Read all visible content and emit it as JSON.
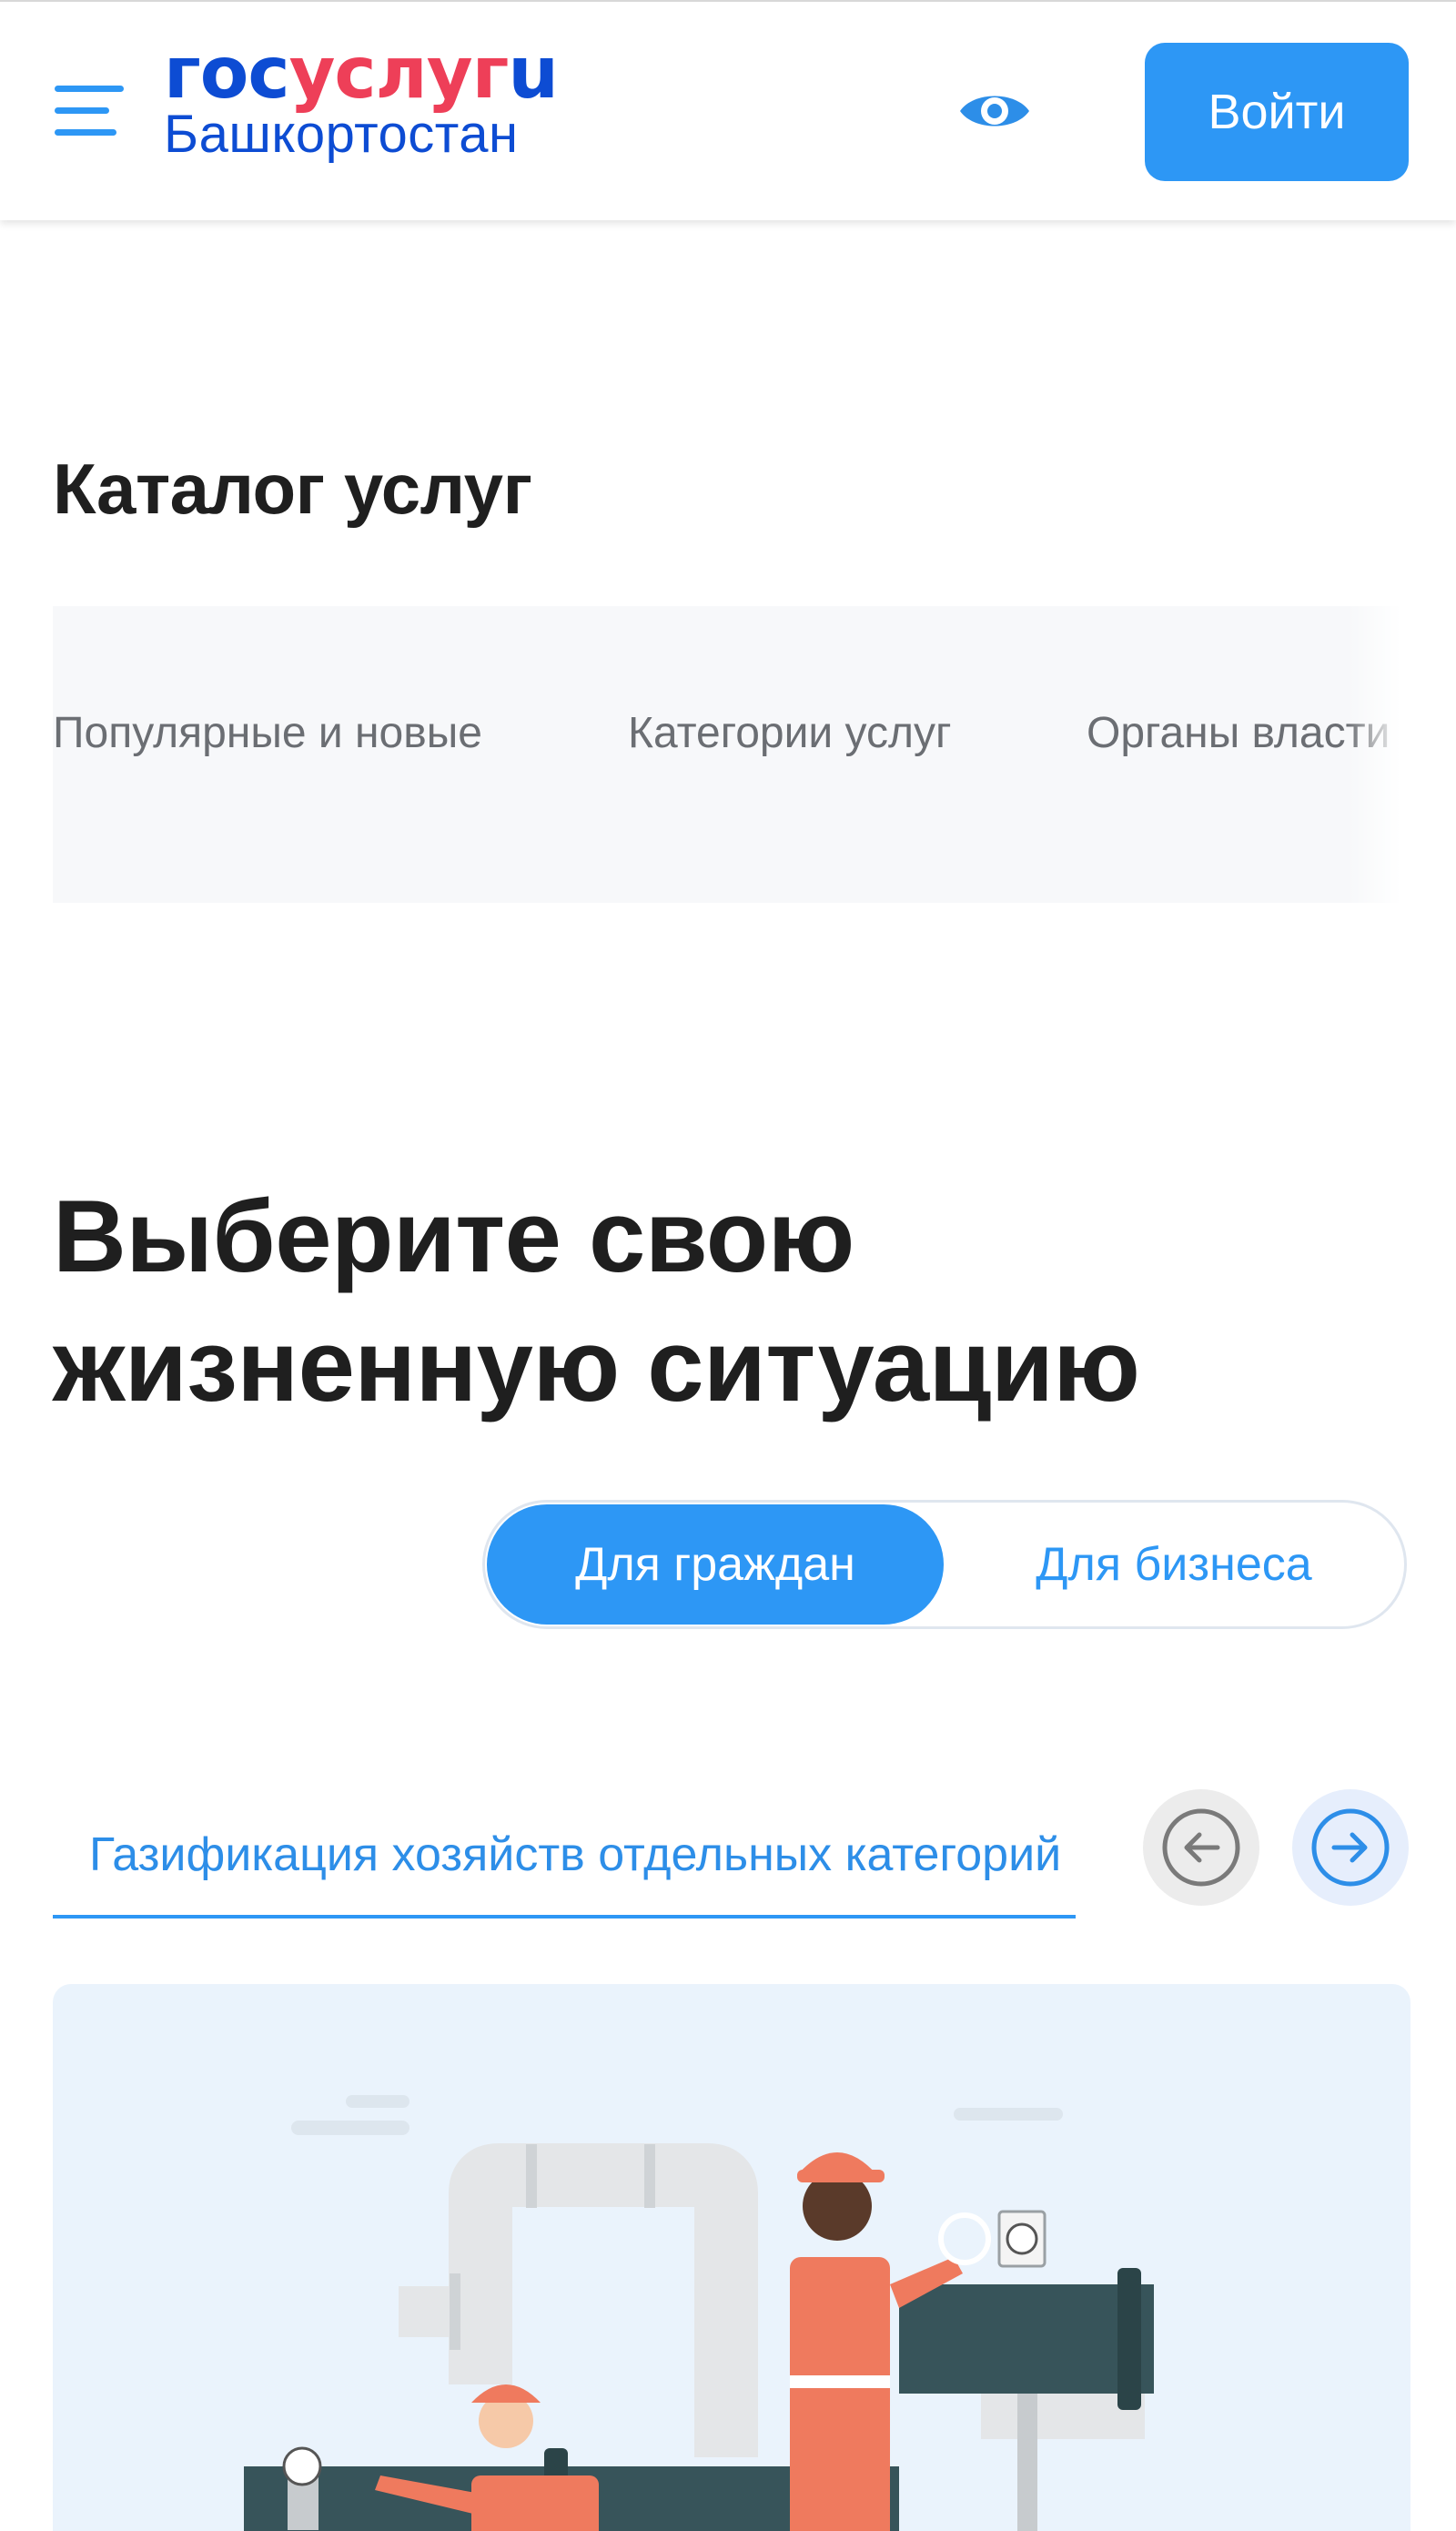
{
  "header": {
    "logo": {
      "part1": "гос",
      "part2": "услуг",
      "part3": "u",
      "region": "Башкортостан"
    },
    "login_label": "Войти"
  },
  "catalog": {
    "title": "Каталог услуг",
    "tabs": [
      "Популярные и новые",
      "Категории услуг",
      "Органы власти"
    ]
  },
  "life_situation": {
    "title_line1": "Выберите свою",
    "title_line2": "жизненную ситуацию",
    "toggle": {
      "citizens": "Для граждан",
      "business": "Для бизнеса",
      "selected": "citizens"
    },
    "active_tab": "Газификация хозяйств отдельных категорий"
  },
  "icons": [
    "menu-icon",
    "eye-icon",
    "arrow-left-icon",
    "arrow-right-icon"
  ],
  "colors": {
    "primary": "#2d97f5",
    "brand_blue": "#0d4cd3",
    "brand_red": "#ee3f58",
    "card_bg": "#eaf3fc"
  }
}
